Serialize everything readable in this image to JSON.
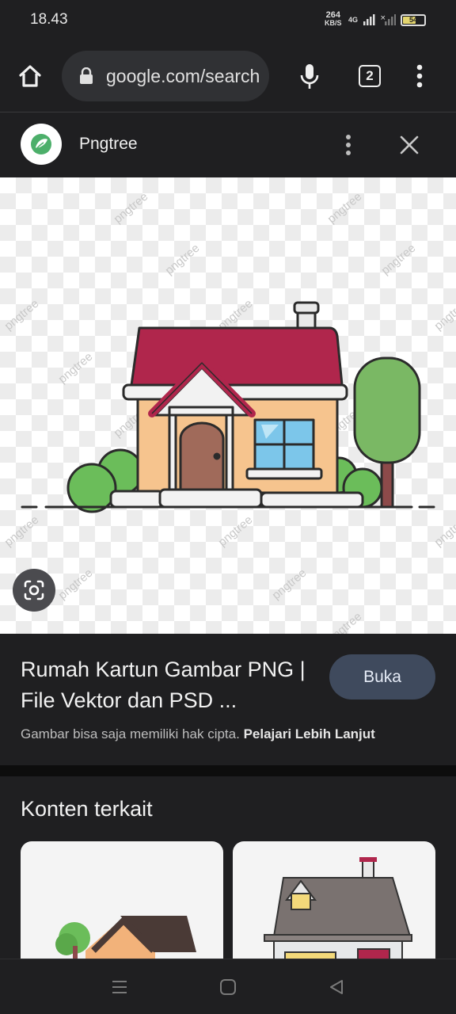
{
  "status_bar": {
    "time": "18.43",
    "net_speed_value": "264",
    "net_speed_unit": "KB/S",
    "network_type": "4G",
    "battery_level": "54"
  },
  "browser": {
    "url": "google.com/search",
    "tab_count": "2"
  },
  "site": {
    "name": "Pngtree"
  },
  "image": {
    "watermark": "pngtree"
  },
  "result": {
    "title": "Rumah Kartun Gambar PNG | File Vektor dan PSD ...",
    "open_button": "Buka",
    "copyright_text": "Gambar bisa saja memiliki hak cipta.",
    "learn_more": "Pelajari Lebih Lanjut"
  },
  "related": {
    "heading": "Konten terkait"
  },
  "colors": {
    "background": "#1f1f21",
    "url_bar": "#303134",
    "open_button": "#3f4a5d",
    "logo_green": "#4caf6a"
  }
}
